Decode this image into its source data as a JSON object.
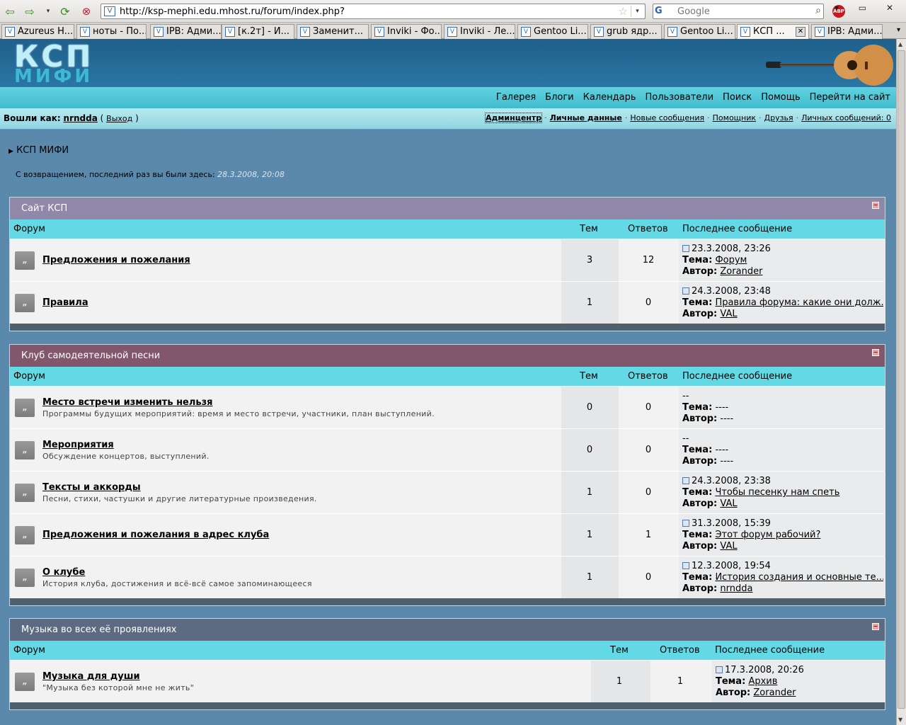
{
  "browser": {
    "url": "http://ksp-mephi.edu.mhost.ru/forum/index.php?",
    "search_placeholder": "Google",
    "search_engine": "G",
    "tabs": [
      {
        "label": "Azureus H..."
      },
      {
        "label": "ноты - По..."
      },
      {
        "label": "IPB: Адми..."
      },
      {
        "label": "[к.2т] - И..."
      },
      {
        "label": "Заменит..."
      },
      {
        "label": "Inviki - Фо..."
      },
      {
        "label": "Inviki - Ле..."
      },
      {
        "label": "Gentoo Li..."
      },
      {
        "label": "grub ядр..."
      },
      {
        "label": "Gentoo Li..."
      },
      {
        "label": "КСП ..."
      },
      {
        "label": "IPB: Адми..."
      }
    ]
  },
  "site": {
    "logo_top": "КСП",
    "logo_bottom": "МИФИ",
    "nav": [
      "Галерея",
      "Блоги",
      "Календарь",
      "Пользователи",
      "Поиск",
      "Помощь",
      "Перейти на сайт"
    ],
    "userbar": {
      "logged_in_as": "Вошли как:",
      "username": "nrndda",
      "logout": "Выход",
      "links": [
        "Админцентр",
        "Личные данные",
        "Новые сообщения",
        "Помощник",
        "Друзья",
        "Личных сообщений: 0"
      ]
    },
    "breadcrumb": "КСП МИФИ",
    "welcome": "С возвращением, последний раз вы были здесь:",
    "welcome_date": "28.3.2008, 20:08"
  },
  "columns": {
    "forum": "Форум",
    "topics": "Тем",
    "replies": "Ответов",
    "last": "Последнее сообщение",
    "topic_label": "Тема:",
    "author_label": "Автор:"
  },
  "sections": [
    {
      "title": "Сайт КСП",
      "color": "#8f88a8",
      "forums": [
        {
          "name": "Предложения и пожелания",
          "desc": "",
          "topics": "3",
          "replies": "12",
          "last_date": "23.3.2008, 23:26",
          "last_topic": "Форум",
          "last_author": "Zorander"
        },
        {
          "name": "Правила",
          "desc": "",
          "topics": "1",
          "replies": "0",
          "last_date": "24.3.2008, 23:48",
          "last_topic": "Правила форума: какие они долж...",
          "last_author": "VAL"
        }
      ]
    },
    {
      "title": "Клуб самодеятельной песни",
      "color": "#82566b",
      "forums": [
        {
          "name": "Место встречи изменить нельзя",
          "desc": "Программы будущих мероприятий: время и место встречи, участники, план выступлений.",
          "topics": "0",
          "replies": "0",
          "last_date": "--",
          "last_topic": "----",
          "last_author": "----"
        },
        {
          "name": "Мероприятия",
          "desc": "Обсуждение концертов, выступлений.",
          "topics": "0",
          "replies": "0",
          "last_date": "--",
          "last_topic": "----",
          "last_author": "----"
        },
        {
          "name": "Тексты и аккорды",
          "desc": "Песни, стихи, частушки и другие литературные произведения.",
          "topics": "1",
          "replies": "0",
          "last_date": "24.3.2008, 23:38",
          "last_topic": "Чтобы песенку нам спеть",
          "last_author": "VAL"
        },
        {
          "name": "Предложения и пожелания в адрес клуба",
          "desc": "",
          "topics": "1",
          "replies": "1",
          "last_date": "31.3.2008, 15:39",
          "last_topic": "Этот форум рабочий?",
          "last_author": "VAL"
        },
        {
          "name": "О клубе",
          "desc": "История клуба, достижения и всё-всё самое запоминающееся",
          "topics": "1",
          "replies": "0",
          "last_date": "12.3.2008, 19:54",
          "last_topic": "История создания и основные те...",
          "last_author": "nrndda"
        }
      ]
    },
    {
      "title": "Музыка во всех её проявлениях",
      "color": "#5d6b82",
      "forums": [
        {
          "name": "Музыка для души",
          "desc": "\"Музыка без которой мне не жить\"",
          "topics": "1",
          "replies": "1",
          "last_date": "17.3.2008, 20:26",
          "last_topic": "Архив",
          "last_author": "Zorander"
        }
      ]
    }
  ]
}
